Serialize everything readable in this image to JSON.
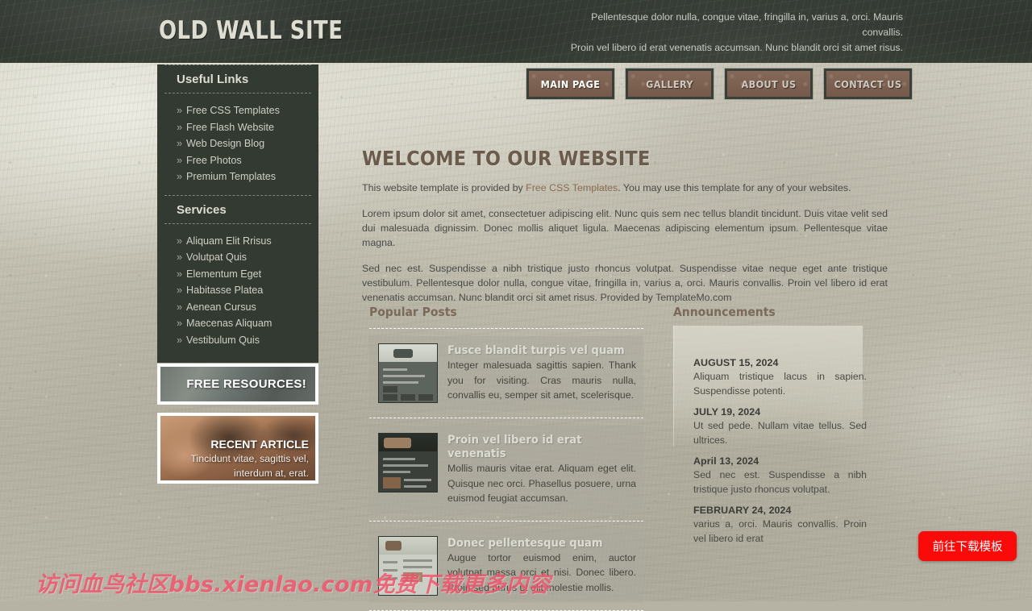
{
  "site": {
    "title": "OLD WALL SITE",
    "tagline_line1": "Pellentesque dolor nulla, congue vitae, fringilla in, varius a, orci. Mauris convallis.",
    "tagline_line2": "Proin vel libero id erat venenatis accumsan. Nunc blandit orci sit amet risus."
  },
  "nav": {
    "items": [
      {
        "label": "MAIN PAGE",
        "active": true
      },
      {
        "label": "GALLERY",
        "active": false
      },
      {
        "label": "ABOUT US",
        "active": false
      },
      {
        "label": "CONTACT US",
        "active": false
      }
    ]
  },
  "sidebar": {
    "useful_links_heading": "Useful Links",
    "useful_links": [
      {
        "label": "Free CSS Templates"
      },
      {
        "label": "Free Flash Website"
      },
      {
        "label": "Web Design Blog"
      },
      {
        "label": "Free Photos"
      },
      {
        "label": "Premium Templates"
      }
    ],
    "services_heading": "Services",
    "services": [
      {
        "label": "Aliquam Elit Rrisus"
      },
      {
        "label": "Volutpat Quis"
      },
      {
        "label": "Elementum Eget"
      },
      {
        "label": "Habitasse Platea"
      },
      {
        "label": "Aenean Cursus"
      },
      {
        "label": "Maecenas Aliquam"
      },
      {
        "label": "Vestibulum Quis"
      }
    ],
    "bullet": "»",
    "banner_free_label": "FREE RESOURCES!",
    "banner_article_title": "RECENT ARTICLE",
    "banner_article_line1": "Tincidunt vitae, sagittis vel,",
    "banner_article_line2": "interdum at, erat."
  },
  "main": {
    "welcome_title": "WELCOME TO OUR WEBSITE",
    "intro_before": "This website template is provided by ",
    "intro_link": "Free CSS Templates",
    "intro_after": ". You may use this template for any of your websites.",
    "paragraph1": "Lorem ipsum dolor sit amet, consectetuer adipiscing elit. Nunc quis sem nec tellus blandit tincidunt. Duis vitae velit sed dui malesuada dignissim. Donec mollis aliquet ligula. Maecenas adipiscing elementum ipsum. Pellentesque vitae magna.",
    "paragraph2": "Sed nec est. Suspendisse a nibh tristique justo rhoncus volutpat. Suspendisse vitae neque eget ante tristique vestibulum. Pellentesque dolor nulla, congue vitae, fringilla in, varius a, orci. Mauris convallis. Proin vel libero id erat venenatis accumsan. Nunc blandit orci sit amet risus. Provided by TemplateMo.com"
  },
  "popular_posts": {
    "heading": "Popular Posts",
    "items": [
      {
        "title": "Fusce blandit turpis vel quam",
        "text": "Integer malesuada sagittis sapien. Thank you for visiting. Cras mauris nulla, convallis eu, semper sit amet, scelerisque."
      },
      {
        "title": "Proin vel libero id erat venenatis",
        "text": "Mollis mauris vitae erat. Aliquam eget elit. Quisque nec orci. Phasellus posuere, urna euismod feugiat accumsan."
      },
      {
        "title": "Donec pellentesque quam",
        "text": "Augue tortor euismod enim, auctor volutpat massa orci et nisi. Donec libero. Proin sed purus ut elit molestie mollis."
      }
    ]
  },
  "announcements": {
    "heading": "Announcements",
    "items": [
      {
        "date": "AUGUST 15, 2024",
        "text": "Aliquam tristique lacus in sapien. Suspendisse potenti."
      },
      {
        "date": "JULY 19, 2024",
        "text": "Ut sed pede. Nullam vitae tellus. Sed ultrices."
      },
      {
        "date": "April 13, 2024",
        "text": "Sed nec est. Suspendisse a nibh tristique justo rhoncus volutpat."
      },
      {
        "date": "FEBRUARY 24, 2024",
        "text": "varius a, orci. Mauris convallis. Proin vel libero id erat"
      }
    ]
  },
  "overlay": {
    "watermark": "访问血鸟社区bbs.xienlao.com免费下载更多内容",
    "download_button": "前往下载模板"
  },
  "colors": {
    "header_bg": "#333a33",
    "sidebar_bg": "#333a32",
    "nav_button": "#7d6252",
    "heading_brown": "#6b5b4d",
    "wall_base": "#bdbaab",
    "accent_red": "#fb0a0a",
    "watermark_pink": "#f2526b"
  }
}
